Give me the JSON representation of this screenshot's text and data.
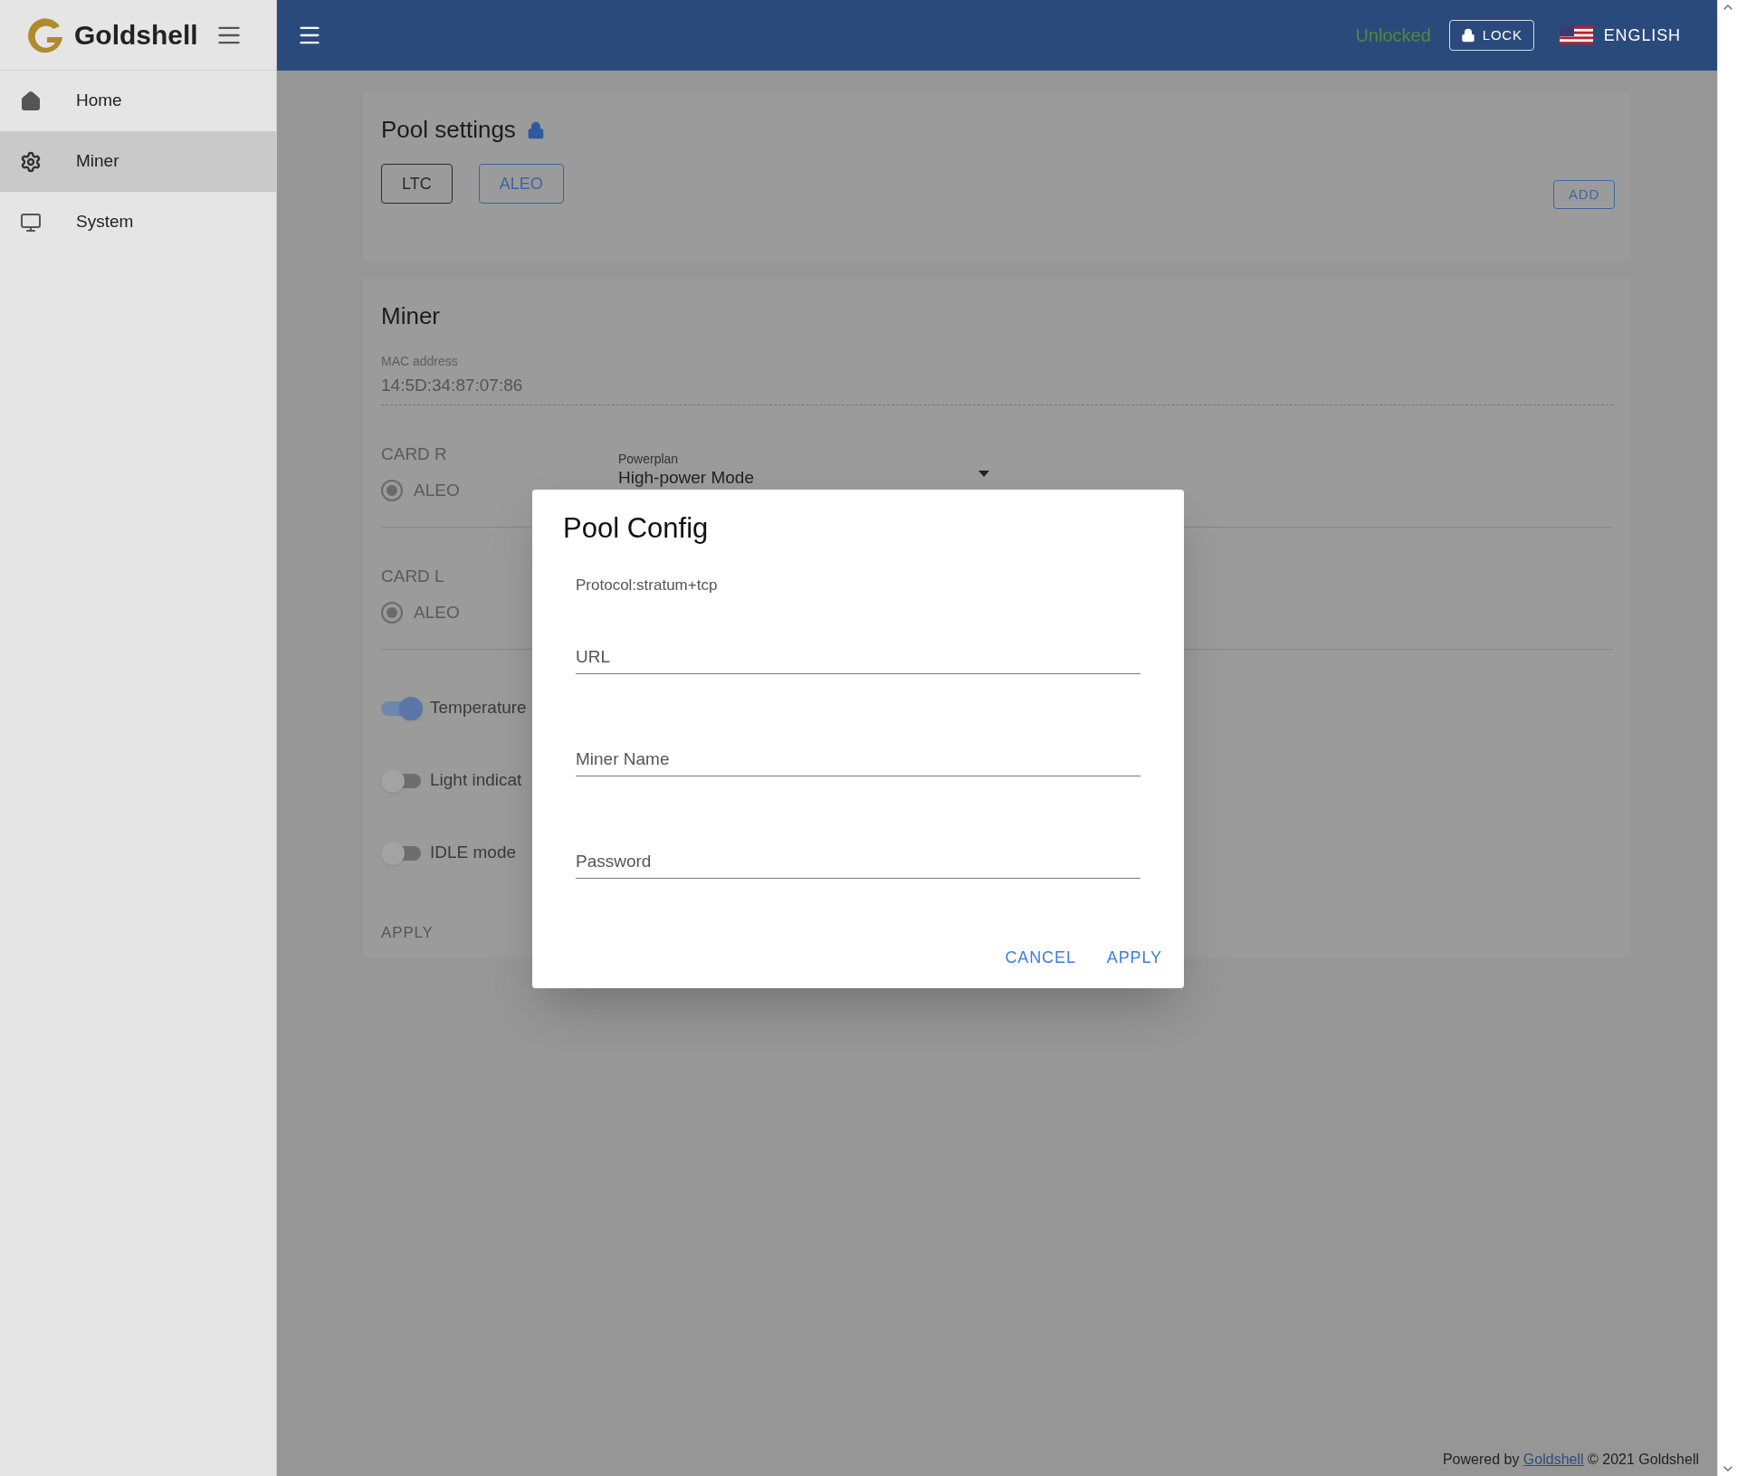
{
  "sidebar": {
    "brand": "Goldshell",
    "items": [
      {
        "label": "Home",
        "selected": false
      },
      {
        "label": "Miner",
        "selected": true
      },
      {
        "label": "System",
        "selected": false
      }
    ]
  },
  "header": {
    "status": "Unlocked",
    "lock_button": "LOCK",
    "language": "ENGLISH"
  },
  "pool_settings": {
    "title": "Pool settings",
    "locked": true,
    "pools": [
      {
        "label": "LTC",
        "selected": true
      },
      {
        "label": "ALEO",
        "selected": false
      }
    ],
    "add_button": "ADD"
  },
  "miner": {
    "title": "Miner",
    "mac_label": "MAC address",
    "mac_value": "14:5D:34:87:07:86",
    "cards": [
      {
        "title": "CARD R",
        "option": {
          "label": "ALEO",
          "selected": true
        }
      },
      {
        "title": "CARD L",
        "option": {
          "label": "ALEO",
          "selected": true
        }
      }
    ],
    "powerplan": {
      "label": "Powerplan",
      "value": "High-power Mode"
    },
    "switches": [
      {
        "label": "Temperature",
        "on": true
      },
      {
        "label": "Light indicat",
        "on": false
      },
      {
        "label": "IDLE mode",
        "on": false
      }
    ],
    "apply_button": "APPLY"
  },
  "dialog": {
    "title": "Pool Config",
    "protocol": "Protocol:stratum+tcp",
    "fields": [
      {
        "placeholder": "URL"
      },
      {
        "placeholder": "Miner Name"
      },
      {
        "placeholder": "Password"
      }
    ],
    "buttons": [
      "CANCEL",
      "APPLY"
    ]
  },
  "footer": {
    "prefix": "Powered by",
    "link": "Goldshell",
    "suffix": "© 2021 Goldshell"
  }
}
